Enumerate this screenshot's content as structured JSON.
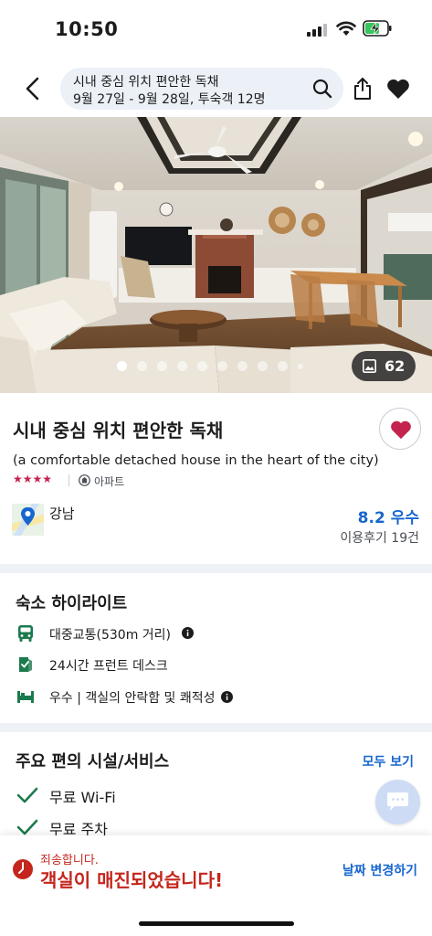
{
  "status_bar": {
    "time": "10:50"
  },
  "header": {
    "search_title": "시내 중심 위치 편안한 독채",
    "search_subtitle": "9월 27일 - 9월 28일, 투숙객 12명"
  },
  "gallery": {
    "photo_count": "62",
    "dot_count": 10,
    "active_index": 0
  },
  "property": {
    "name": "시내 중심 위치 편안한 독채",
    "subtitle": "(a comfortable detached house in the heart of the city)",
    "stars": "★★★★",
    "type": "아파트",
    "location": "강남",
    "rating": "8.2 우수",
    "reviews": "이용후기 19건"
  },
  "highlights": {
    "title": "숙소 하이라이트",
    "items": [
      {
        "icon": "bus-icon",
        "text": "대중교통(530m 거리)",
        "info": true
      },
      {
        "icon": "front-desk-icon",
        "text": "24시간 프런트 데스크",
        "info": false
      },
      {
        "icon": "bed-icon",
        "text": "우수 | 객실의 안락함 및 쾌적성",
        "info": true
      }
    ]
  },
  "amenities": {
    "title": "주요 편의 시설/서비스",
    "see_all": "모두 보기",
    "items": [
      "무료 Wi-Fi",
      "무료 주차"
    ]
  },
  "alert": {
    "sorry": "죄송합니다.",
    "message": "객실이 매진되었습니다!",
    "action": "날짜 변경하기"
  },
  "colors": {
    "accent": "#1766d0",
    "heart": "#c4234f",
    "alert": "#c4261d",
    "green": "#1d7a4d",
    "band": "#eef2f7"
  }
}
